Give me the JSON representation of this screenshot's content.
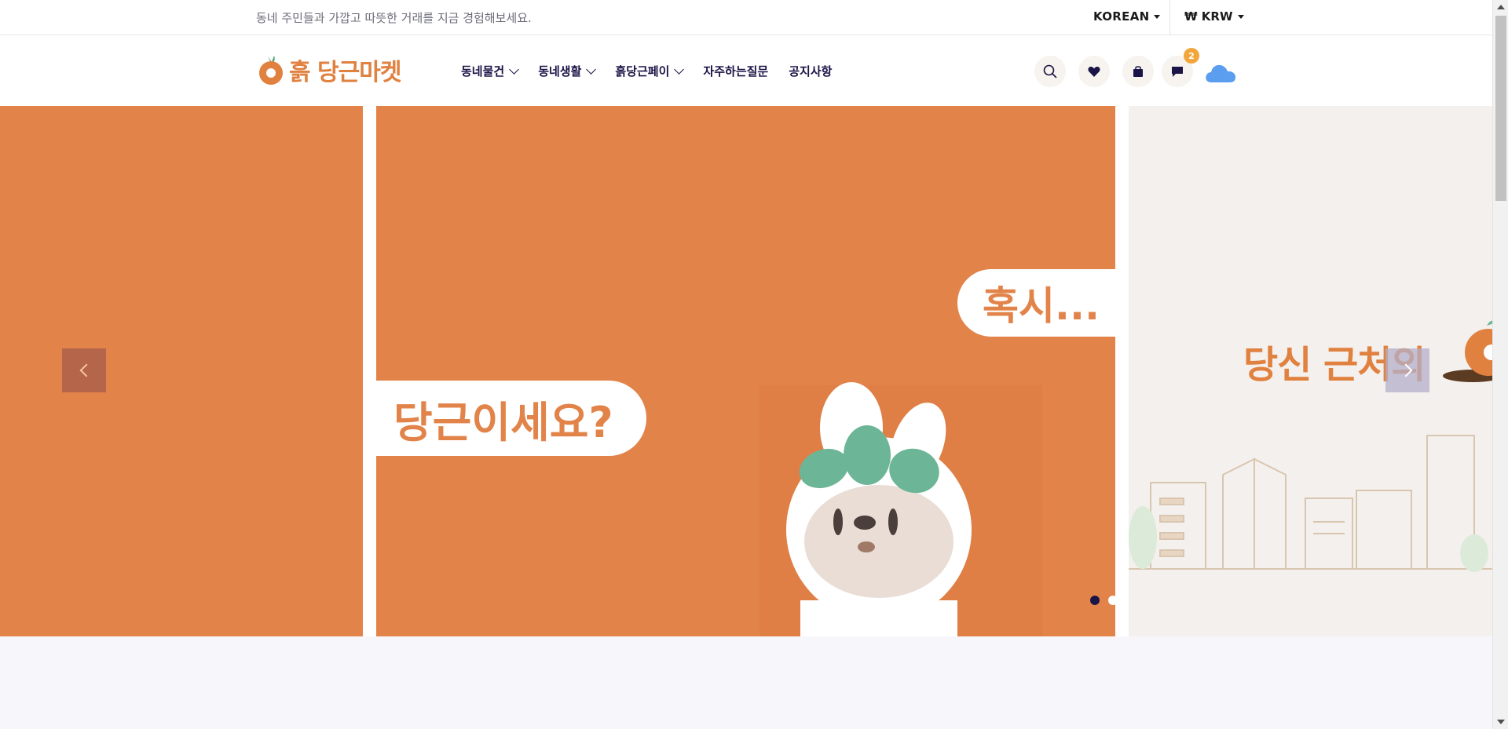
{
  "topbar": {
    "tagline": "동네 주민들과 가깝고 따뜻한 거래를 지금 경험해보세요.",
    "language": "KOREAN",
    "currency": "₩ KRW"
  },
  "header": {
    "logo_text": "흙 당근마켓",
    "nav": [
      {
        "label": "동네물건",
        "has_dropdown": true
      },
      {
        "label": "동네생활",
        "has_dropdown": true
      },
      {
        "label": "흙당근페이",
        "has_dropdown": true
      },
      {
        "label": "자주하는질문",
        "has_dropdown": false
      },
      {
        "label": "공지사항",
        "has_dropdown": false
      }
    ],
    "icons": [
      "search-icon",
      "heart-icon",
      "bag-icon",
      "chat-icon",
      "cloud-icon"
    ],
    "chat_badge": "2"
  },
  "hero": {
    "bubble_top": "혹시...",
    "bubble_main": "당근이세요?",
    "right_slide_title": "당신 근처의",
    "active_dot": 0,
    "dot_count": 4
  },
  "colors": {
    "brand_orange": "#e2844a",
    "navy": "#1b1446",
    "badge": "#f2a63c",
    "cloud": "#5b9ef0",
    "mascot_leaf": "#6db597"
  }
}
